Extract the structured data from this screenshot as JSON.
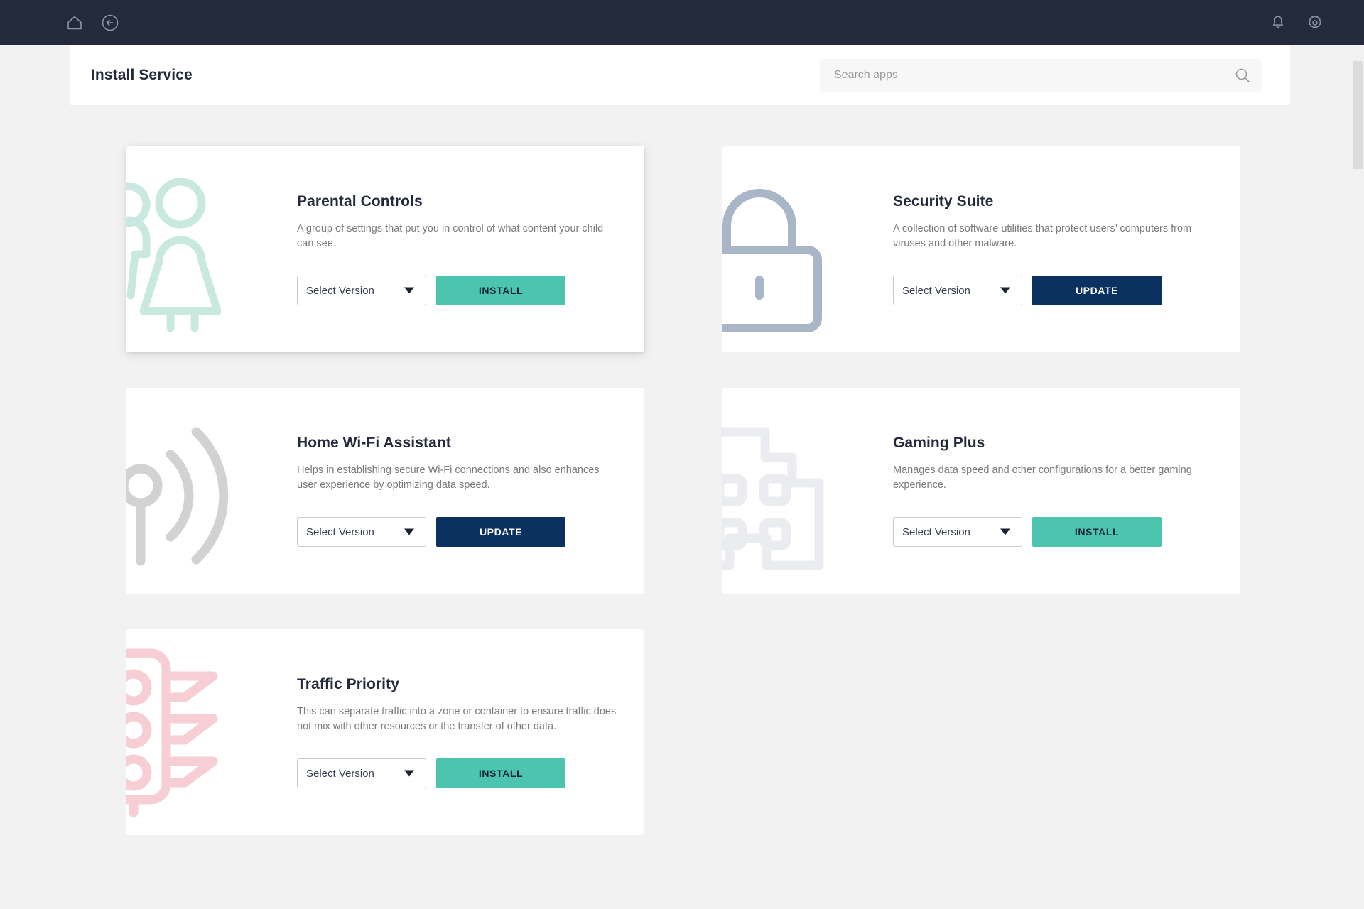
{
  "topbar": {
    "left_icons": [
      {
        "name": "home-icon",
        "label": "Home"
      },
      {
        "name": "back-icon",
        "label": "Back"
      }
    ],
    "right_icons": [
      {
        "name": "bell-icon",
        "label": "Notifications"
      },
      {
        "name": "gear-icon",
        "label": "Settings"
      }
    ]
  },
  "header": {
    "title": "Install Service",
    "search": {
      "placeholder": "Search apps",
      "value": "",
      "icon": "search-icon"
    }
  },
  "colors": {
    "topbar_bg": "#232a3b",
    "page_bg": "#f2f2f2",
    "card_bg": "#ffffff",
    "title": "#232a3b",
    "description": "#7a7a7a",
    "install_button": "#4bc5ad",
    "install_button_text": "#1b2233",
    "update_button": "#0b3160",
    "update_button_text": "#ffffff",
    "art_parental": "#c9e8df",
    "art_security": "#a8b6c8",
    "art_wifi": "#d2d2d2",
    "art_gaming": "#ebecf0",
    "art_traffic": "#f7ced4"
  },
  "cards": [
    {
      "id": "parental-controls",
      "title": "Parental Controls",
      "description": "A group of settings that put you in control of what content your child can see.",
      "icon": "family-icon",
      "art_color": "#c9e8df",
      "version_label": "Select Version",
      "action_label": "INSTALL",
      "action_type": "install",
      "elevated": true
    },
    {
      "id": "security-suite",
      "title": "Security Suite",
      "description": "A collection of software utilities that protect users’ computers from viruses and other malware.",
      "icon": "padlock-icon",
      "art_color": "#a8b6c8",
      "version_label": "Select Version",
      "action_label": "UPDATE",
      "action_type": "update",
      "elevated": false
    },
    {
      "id": "home-wifi-assistant",
      "title": "Home Wi-Fi Assistant",
      "description": "Helps in establishing secure Wi-Fi connections and also enhances user experience by optimizing data speed.",
      "icon": "wifi-signal-icon",
      "art_color": "#d2d2d2",
      "version_label": "Select Version",
      "action_label": "UPDATE",
      "action_type": "update",
      "elevated": false
    },
    {
      "id": "gaming-plus",
      "title": "Gaming Plus",
      "description": "Manages data speed and other configurations for a better gaming experience.",
      "icon": "gamepad-icon",
      "art_color": "#ebecf0",
      "version_label": "Select Version",
      "action_label": "INSTALL",
      "action_type": "install",
      "elevated": false
    },
    {
      "id": "traffic-priority",
      "title": "Traffic Priority",
      "description": "This can separate traffic into a zone or container to ensure traffic does not mix with other resources or the transfer of other data.",
      "icon": "traffic-light-icon",
      "art_color": "#f7ced4",
      "version_label": "Select Version",
      "action_label": "INSTALL",
      "action_type": "install",
      "elevated": false
    }
  ],
  "scrollbar": {
    "name": "vertical-scrollbar"
  }
}
